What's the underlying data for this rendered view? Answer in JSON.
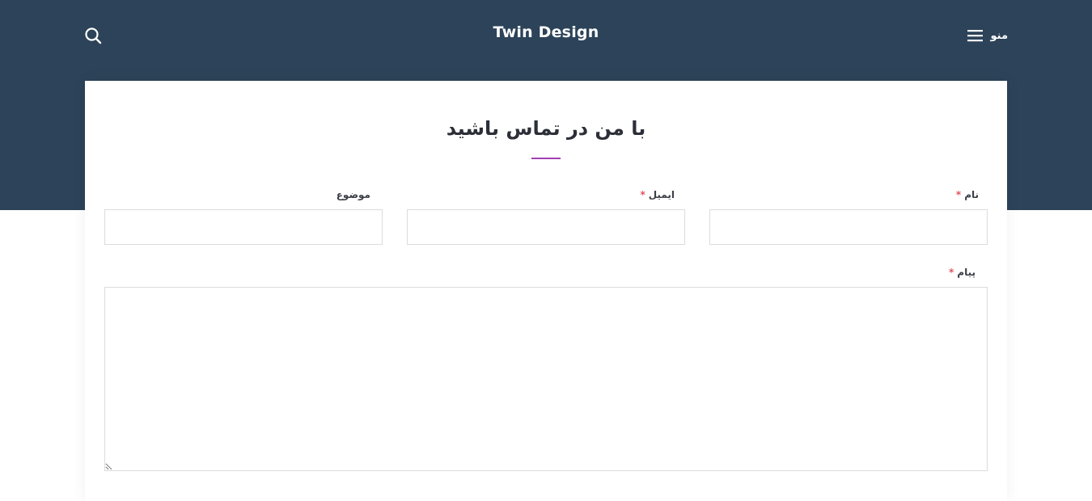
{
  "header": {
    "site_title": "Twin Design",
    "menu_label": "منو",
    "background_color": "#2c4359",
    "icons": {
      "search": "search-icon",
      "menu": "hamburger-menu-icon"
    }
  },
  "contact_form": {
    "heading": "با من در تماس باشید",
    "accent_color": "#a33fb2",
    "required_mark": "*",
    "required_color": "#e0505f",
    "fields": {
      "name": {
        "label": "نام",
        "value": "",
        "required": true
      },
      "email": {
        "label": "ایمیل",
        "value": "",
        "required": true
      },
      "subject": {
        "label": "موضوع",
        "value": "",
        "required": false
      },
      "message": {
        "label": "پیام",
        "value": "",
        "required": true
      }
    }
  }
}
